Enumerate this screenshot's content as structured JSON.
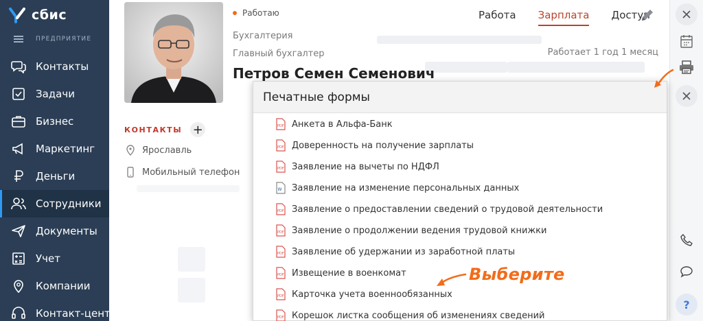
{
  "brand": {
    "name": "сбис"
  },
  "sidebar": {
    "section_label": "ПРЕДПРИЯТИЕ",
    "items": [
      {
        "label": "Контакты",
        "icon": "chat-bubbles-icon"
      },
      {
        "label": "Задачи",
        "icon": "tasks-icon"
      },
      {
        "label": "Бизнес",
        "icon": "briefcase-icon"
      },
      {
        "label": "Маркетинг",
        "icon": "megaphone-icon"
      },
      {
        "label": "Деньги",
        "icon": "ruble-icon"
      },
      {
        "label": "Сотрудники",
        "icon": "employees-icon",
        "active": true
      },
      {
        "label": "Документы",
        "icon": "paper-plane-icon"
      },
      {
        "label": "Учет",
        "icon": "accounting-icon"
      },
      {
        "label": "Компании",
        "icon": "location-pin-icon"
      },
      {
        "label": "Контакт-центр",
        "icon": "headset-icon"
      }
    ]
  },
  "employee": {
    "status": "Работаю",
    "department": "Бухгалтерия",
    "position": "Главный бухгалтер",
    "full_name": "Петров Семен Семенович",
    "tenure": "Работает 1 год 1 месяц"
  },
  "tabs": [
    {
      "label": "Работа"
    },
    {
      "label": "Зарплата",
      "active": true
    },
    {
      "label": "Доступ"
    }
  ],
  "contacts": {
    "title": "КОНТАКТЫ",
    "add_label": "+",
    "city": "Ярославль",
    "phone": "Мобильный телефон"
  },
  "popup": {
    "title": "Печатные формы",
    "forms": [
      {
        "label": "Анкета в Альфа-Банк",
        "icon": "pdf-icon"
      },
      {
        "label": "Доверенность на получение зарплаты",
        "icon": "pdf-icon"
      },
      {
        "label": "Заявление на вычеты по НДФЛ",
        "icon": "pdf-icon"
      },
      {
        "label": "Заявление на изменение персональных данных",
        "icon": "word-icon"
      },
      {
        "label": "Заявление о предоставлении сведений о трудовой деятельности",
        "icon": "pdf-icon"
      },
      {
        "label": "Заявление о продолжении ведения трудовой книжки",
        "icon": "pdf-icon"
      },
      {
        "label": "Заявление об удержании из заработной платы",
        "icon": "pdf-icon"
      },
      {
        "label": "Извещение в военкомат",
        "icon": "pdf-icon"
      },
      {
        "label": "Карточка учета военнообязанных",
        "icon": "pdf-icon"
      },
      {
        "label": "Корешок листка сообщения об изменениях сведений",
        "icon": "pdf-icon"
      }
    ]
  },
  "hint": {
    "text": "Выберите"
  },
  "help_label": "?",
  "colors": {
    "sidebar": "#2b3e55",
    "accent": "#f26c1a",
    "active_tab": "#b9442b"
  }
}
